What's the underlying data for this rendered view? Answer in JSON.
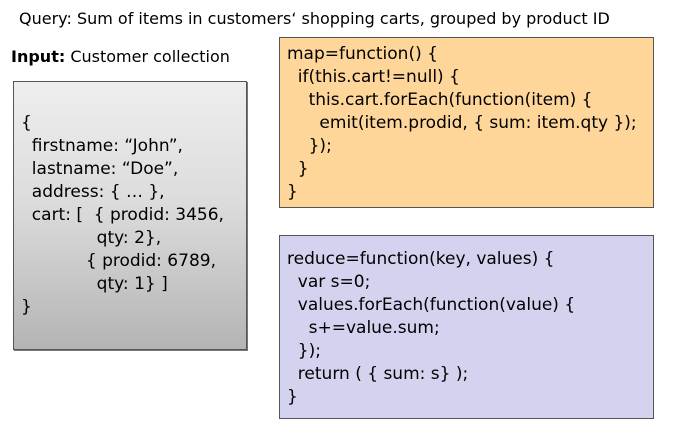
{
  "query": "Query: Sum of items in customers‘ shopping carts, grouped by product ID",
  "input": {
    "label_bold": "Input:",
    "label_text": " Customer collection"
  },
  "customer_document": {
    "lines": [
      "{",
      "  firstname: “John”,",
      "  lastname: “Doe”,",
      "  address: { … },",
      "  cart: [  { prodid: 3456,",
      "              qty: 2},",
      "            { prodid: 6789,",
      "              qty: 1} ]",
      "}"
    ]
  },
  "map_function": {
    "lines": [
      "map=function() {",
      "  if(this.cart!=null) {",
      "    this.cart.forEach(function(item) {",
      "      emit(item.prodid, { sum: item.qty });",
      "    });",
      "  }",
      "}"
    ]
  },
  "reduce_function": {
    "lines": [
      "reduce=function(key, values) {",
      "  var s=0;",
      "  values.forEach(function(value) {",
      "    s+=value.sum;",
      "  });",
      "  return ( { sum: s} );",
      "}"
    ]
  },
  "colors": {
    "map_background": "#ffd699",
    "reduce_background": "#d3d3f0",
    "customer_background": "#dcdcdc"
  }
}
